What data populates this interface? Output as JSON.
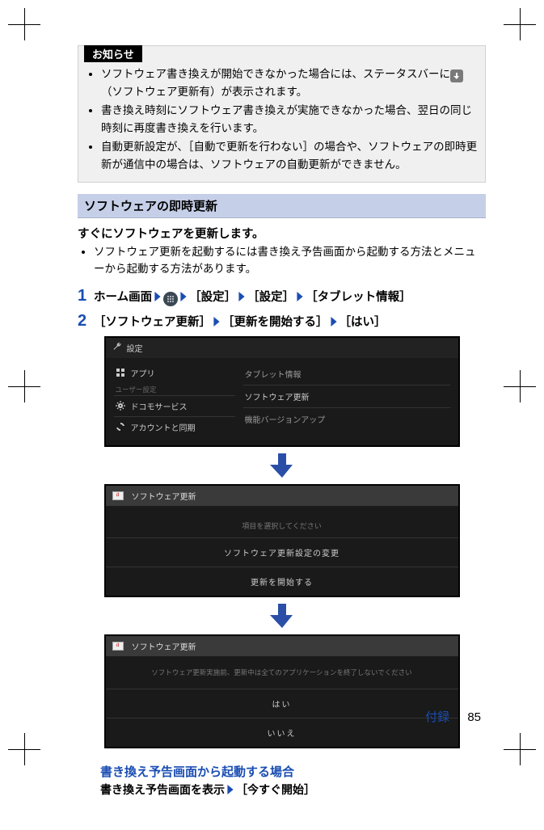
{
  "notice": {
    "tag": "お知らせ",
    "items": [
      "ソフトウェア書き換えが開始できなかった場合には、ステータスバーに （ソフトウェア更新有）が表示されます。",
      "書き換え時刻にソフトウェア書き換えが実施できなかった場合、翌日の同じ時刻に再度書き換えを行います。",
      "自動更新設定が、［自動で更新を行わない］の場合や、ソフトウェアの即時更新が通信中の場合は、ソフトウェアの自動更新ができません。"
    ]
  },
  "section_title": "ソフトウェアの即時更新",
  "lead": "すぐにソフトウェアを更新します。",
  "lead_bullet": "ソフトウェア更新を起動するには書き換え予告画面から起動する方法とメニューから起動する方法があります。",
  "step1": {
    "num": "1",
    "p1": "ホーム画面",
    "p2": "［設定］",
    "p3": "［設定］",
    "p4": "［タブレット情報］"
  },
  "step2": {
    "num": "2",
    "p1": "［ソフトウェア更新］",
    "p2": "［更新を開始する］",
    "p3": "［はい］"
  },
  "shot1": {
    "title": "設定",
    "left": {
      "apps": "アプリ",
      "user_hdr": "ユーザー設定",
      "docomo": "ドコモサービス",
      "account": "アカウントと同期"
    },
    "right": {
      "l1": "タブレット情報",
      "l2": "ソフトウェア更新",
      "l3": "機能バージョンアップ"
    }
  },
  "shot2": {
    "title": "ソフトウェア更新",
    "msg": "項目を選択してください",
    "opt1": "ソフトウェア更新設定の変更",
    "opt2": "更新を開始する"
  },
  "shot3": {
    "title": "ソフトウェア更新",
    "msg": "ソフトウェア更新実施前、更新中は全てのアプリケーションを終了しないでください",
    "yes": "はい",
    "no": "いいえ"
  },
  "sub": {
    "head": "書き換え予告画面から起動する場合",
    "line_a": "書き換え予告画面を表示",
    "line_b": "［今すぐ開始］"
  },
  "footer": {
    "appendix": "付録",
    "page": "85"
  }
}
